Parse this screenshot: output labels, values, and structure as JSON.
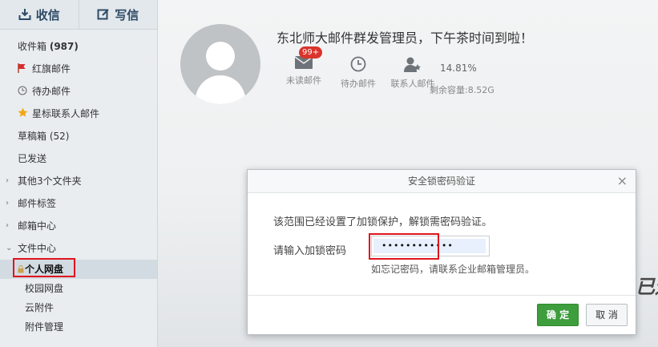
{
  "sidebar": {
    "inbox_btn": "收信",
    "compose_btn": "写信",
    "items": [
      {
        "label": "收件箱",
        "count": "(987)"
      },
      {
        "label": "红旗邮件"
      },
      {
        "label": "待办邮件"
      },
      {
        "label": "星标联系人邮件"
      },
      {
        "label": "草稿箱 (52)"
      },
      {
        "label": "已发送"
      },
      {
        "label": "其他3个文件夹"
      },
      {
        "label": "邮件标签"
      },
      {
        "label": "邮箱中心"
      },
      {
        "label": "文件中心"
      }
    ],
    "file_sub": [
      "个人网盘",
      "校园网盘",
      "云附件",
      "附件管理"
    ]
  },
  "profile": {
    "greeting": "东北师大邮件群发管理员，下午茶时间到啦！",
    "unread_badge": "99+",
    "unread_label": "未读邮件",
    "todo_label": "待办邮件",
    "contacts_label": "联系人邮件",
    "quota_pct": "14.81%",
    "quota_label": "剩余容量:8.52G",
    "side_text": "已迹"
  },
  "dialog": {
    "title": "安全锁密码验证",
    "close": "×",
    "message": "该范围已经设置了加锁保护，解锁需密码验证。",
    "input_label": "请输入加锁密码",
    "input_value": "••••••••••••",
    "hint": "如忘记密码，请联系企业邮箱管理员。",
    "ok": "确 定",
    "cancel": "取 消"
  },
  "colors": {
    "accent_green": "#3e9d3c",
    "highlight_red": "#e0141e",
    "badge_red": "#d9342b"
  }
}
